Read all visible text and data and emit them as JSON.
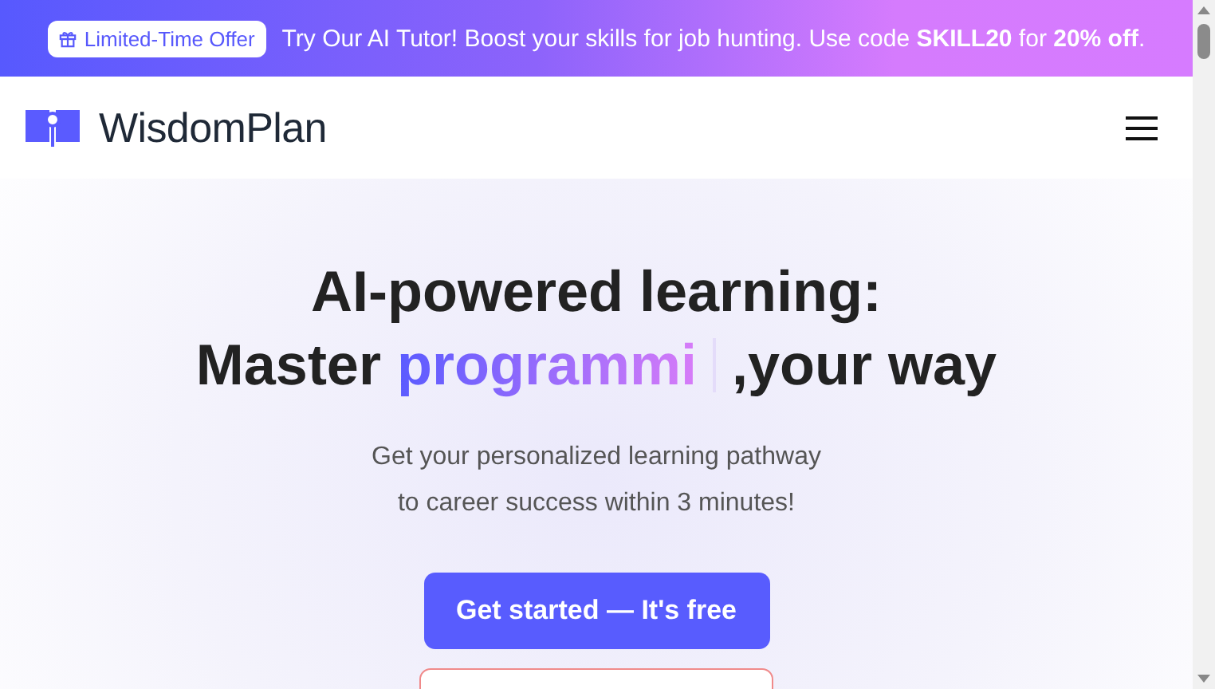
{
  "banner": {
    "badge": "Limited-Time Offer",
    "message": "Try Our AI Tutor! Boost your skills for job hunting. Use code **SKILL20** for **20% off**."
  },
  "header": {
    "brand": "WisdomPlan"
  },
  "hero": {
    "title_line_1": "AI-powered learning:",
    "title_prefix": "Master",
    "title_highlight": "programmi",
    "title_suffix": ",your way",
    "subtitle_lines": [
      "Get your personalized learning pathway",
      "to career success within 3 minutes!"
    ],
    "primary_button": "Get started — It's free"
  }
}
